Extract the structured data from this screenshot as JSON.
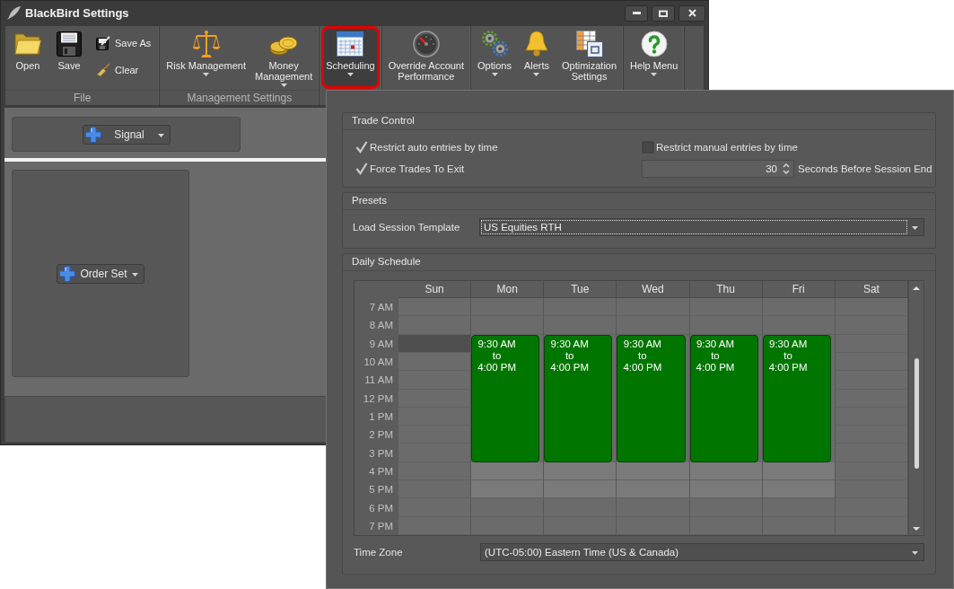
{
  "window": {
    "title": "BlackBird Settings"
  },
  "ribbon": {
    "groups": [
      {
        "label": "File",
        "buttons": [
          {
            "kind": "large",
            "label": "Open",
            "dropdown": false,
            "highlighted": false
          },
          {
            "kind": "large",
            "label": "Save",
            "dropdown": false,
            "highlighted": false
          },
          {
            "kind": "small",
            "label": "Save As",
            "dropdown": false,
            "highlighted": false
          },
          {
            "kind": "small",
            "label": "Clear",
            "dropdown": false,
            "highlighted": false
          }
        ]
      },
      {
        "label": "Management Settings",
        "buttons": [
          {
            "kind": "large",
            "label": "Risk Management",
            "dropdown": true,
            "highlighted": false
          },
          {
            "kind": "large",
            "label": "Money\nManagement",
            "dropdown": true,
            "highlighted": false
          }
        ]
      },
      {
        "buttons": [
          {
            "kind": "large",
            "label": "Scheduling",
            "dropdown": true,
            "highlighted": true
          }
        ]
      },
      {
        "buttons": [
          {
            "kind": "large",
            "label": "Override Account\nPerformance",
            "dropdown": false,
            "highlighted": false
          }
        ]
      },
      {
        "buttons": [
          {
            "kind": "large",
            "label": "Options",
            "dropdown": true,
            "highlighted": false
          },
          {
            "kind": "large",
            "label": "Alerts",
            "dropdown": true,
            "highlighted": false
          },
          {
            "kind": "large",
            "label": "Optimization\nSettings",
            "dropdown": false,
            "highlighted": false
          }
        ]
      },
      {
        "buttons": [
          {
            "kind": "large",
            "label": "Help Menu",
            "dropdown": true,
            "highlighted": false
          }
        ]
      }
    ]
  },
  "strategy": {
    "signal_button": {
      "label": "Signal"
    },
    "order_set_button": {
      "label": "Order Set"
    }
  },
  "session_settings": {
    "trade_control": {
      "title": "Trade Control",
      "options": [
        {
          "label": "Restrict auto entries by time",
          "checked": true
        },
        {
          "label": "Restrict manual entries by time",
          "checked": false
        },
        {
          "label": "Force Trades To Exit",
          "checked": true
        }
      ],
      "exit_seconds": {
        "value": "30",
        "label": "Seconds Before Session End"
      }
    },
    "presets": {
      "title": "Presets",
      "session_template": {
        "label": "Load Session Template",
        "value": "US Equities RTH",
        "focused": true
      }
    },
    "daily_schedule": {
      "title": "Daily Schedule",
      "hours": [
        "7 AM",
        "8 AM",
        "9 AM",
        "10 AM",
        "11 AM",
        "12 PM",
        "1 PM",
        "2 PM",
        "3 PM",
        "4 PM",
        "5 PM",
        "6 PM",
        "7 PM"
      ],
      "days": [
        {
          "label": "Sun",
          "hours": [
            {
              "kind": "off",
              "selected": false
            },
            {
              "kind": "off",
              "selected": false
            },
            {
              "kind": "off",
              "selected": true
            },
            {
              "kind": "off",
              "selected": false
            },
            {
              "kind": "off",
              "selected": false
            },
            {
              "kind": "off",
              "selected": false
            },
            {
              "kind": "off",
              "selected": false
            },
            {
              "kind": "off",
              "selected": false
            },
            {
              "kind": "off",
              "selected": false
            },
            {
              "kind": "off",
              "selected": false
            },
            {
              "kind": "off",
              "selected": false
            },
            {
              "kind": "off",
              "selected": false
            },
            {
              "kind": "off",
              "selected": false
            }
          ]
        },
        {
          "label": "Mon",
          "session": {
            "start": "9:30 AM",
            "to": "to",
            "end": "4:00 PM"
          },
          "hours": [
            {
              "kind": "off",
              "selected": false
            },
            {
              "kind": "off",
              "selected": false
            },
            {
              "kind": "session"
            },
            {
              "kind": "session"
            },
            {
              "kind": "session"
            },
            {
              "kind": "session"
            },
            {
              "kind": "session"
            },
            {
              "kind": "session"
            },
            {
              "kind": "session"
            },
            {
              "kind": "work",
              "selected": false
            },
            {
              "kind": "work",
              "selected": false
            },
            {
              "kind": "off",
              "selected": false
            },
            {
              "kind": "off",
              "selected": false
            }
          ]
        },
        {
          "label": "Tue",
          "session": {
            "start": "9:30 AM",
            "to": "to",
            "end": "4:00 PM"
          },
          "hours": [
            {
              "kind": "off",
              "selected": false
            },
            {
              "kind": "off",
              "selected": false
            },
            {
              "kind": "session"
            },
            {
              "kind": "session"
            },
            {
              "kind": "session"
            },
            {
              "kind": "session"
            },
            {
              "kind": "session"
            },
            {
              "kind": "session"
            },
            {
              "kind": "session"
            },
            {
              "kind": "work",
              "selected": false
            },
            {
              "kind": "work",
              "selected": false
            },
            {
              "kind": "off",
              "selected": false
            },
            {
              "kind": "off",
              "selected": false
            }
          ]
        },
        {
          "label": "Wed",
          "session": {
            "start": "9:30 AM",
            "to": "to",
            "end": "4:00 PM"
          },
          "hours": [
            {
              "kind": "off",
              "selected": false
            },
            {
              "kind": "off",
              "selected": false
            },
            {
              "kind": "session"
            },
            {
              "kind": "session"
            },
            {
              "kind": "session"
            },
            {
              "kind": "session"
            },
            {
              "kind": "session"
            },
            {
              "kind": "session"
            },
            {
              "kind": "session"
            },
            {
              "kind": "work",
              "selected": false
            },
            {
              "kind": "work",
              "selected": false
            },
            {
              "kind": "off",
              "selected": false
            },
            {
              "kind": "off",
              "selected": false
            }
          ]
        },
        {
          "label": "Thu",
          "session": {
            "start": "9:30 AM",
            "to": "to",
            "end": "4:00 PM"
          },
          "hours": [
            {
              "kind": "off",
              "selected": false
            },
            {
              "kind": "off",
              "selected": false
            },
            {
              "kind": "session"
            },
            {
              "kind": "session"
            },
            {
              "kind": "session"
            },
            {
              "kind": "session"
            },
            {
              "kind": "session"
            },
            {
              "kind": "session"
            },
            {
              "kind": "session"
            },
            {
              "kind": "work",
              "selected": false
            },
            {
              "kind": "work",
              "selected": false
            },
            {
              "kind": "off",
              "selected": false
            },
            {
              "kind": "off",
              "selected": false
            }
          ]
        },
        {
          "label": "Fri",
          "session": {
            "start": "9:30 AM",
            "to": "to",
            "end": "4:00 PM"
          },
          "hours": [
            {
              "kind": "off",
              "selected": false
            },
            {
              "kind": "off",
              "selected": false
            },
            {
              "kind": "session"
            },
            {
              "kind": "session"
            },
            {
              "kind": "session"
            },
            {
              "kind": "session"
            },
            {
              "kind": "session"
            },
            {
              "kind": "session"
            },
            {
              "kind": "session"
            },
            {
              "kind": "work",
              "selected": false
            },
            {
              "kind": "work",
              "selected": false
            },
            {
              "kind": "off",
              "selected": false
            },
            {
              "kind": "off",
              "selected": false
            }
          ]
        },
        {
          "label": "Sat",
          "hours": [
            {
              "kind": "off",
              "selected": false
            },
            {
              "kind": "off",
              "selected": false
            },
            {
              "kind": "off",
              "selected": false
            },
            {
              "kind": "off",
              "selected": false
            },
            {
              "kind": "off",
              "selected": false
            },
            {
              "kind": "off",
              "selected": false
            },
            {
              "kind": "off",
              "selected": false
            },
            {
              "kind": "off",
              "selected": false
            },
            {
              "kind": "off",
              "selected": false
            },
            {
              "kind": "off",
              "selected": false
            },
            {
              "kind": "off",
              "selected": false
            },
            {
              "kind": "off",
              "selected": false
            },
            {
              "kind": "off",
              "selected": false
            }
          ]
        }
      ],
      "time_zone": {
        "label": "Time Zone",
        "value": "(UTC-05:00) Eastern Time (US & Canada)"
      }
    }
  }
}
